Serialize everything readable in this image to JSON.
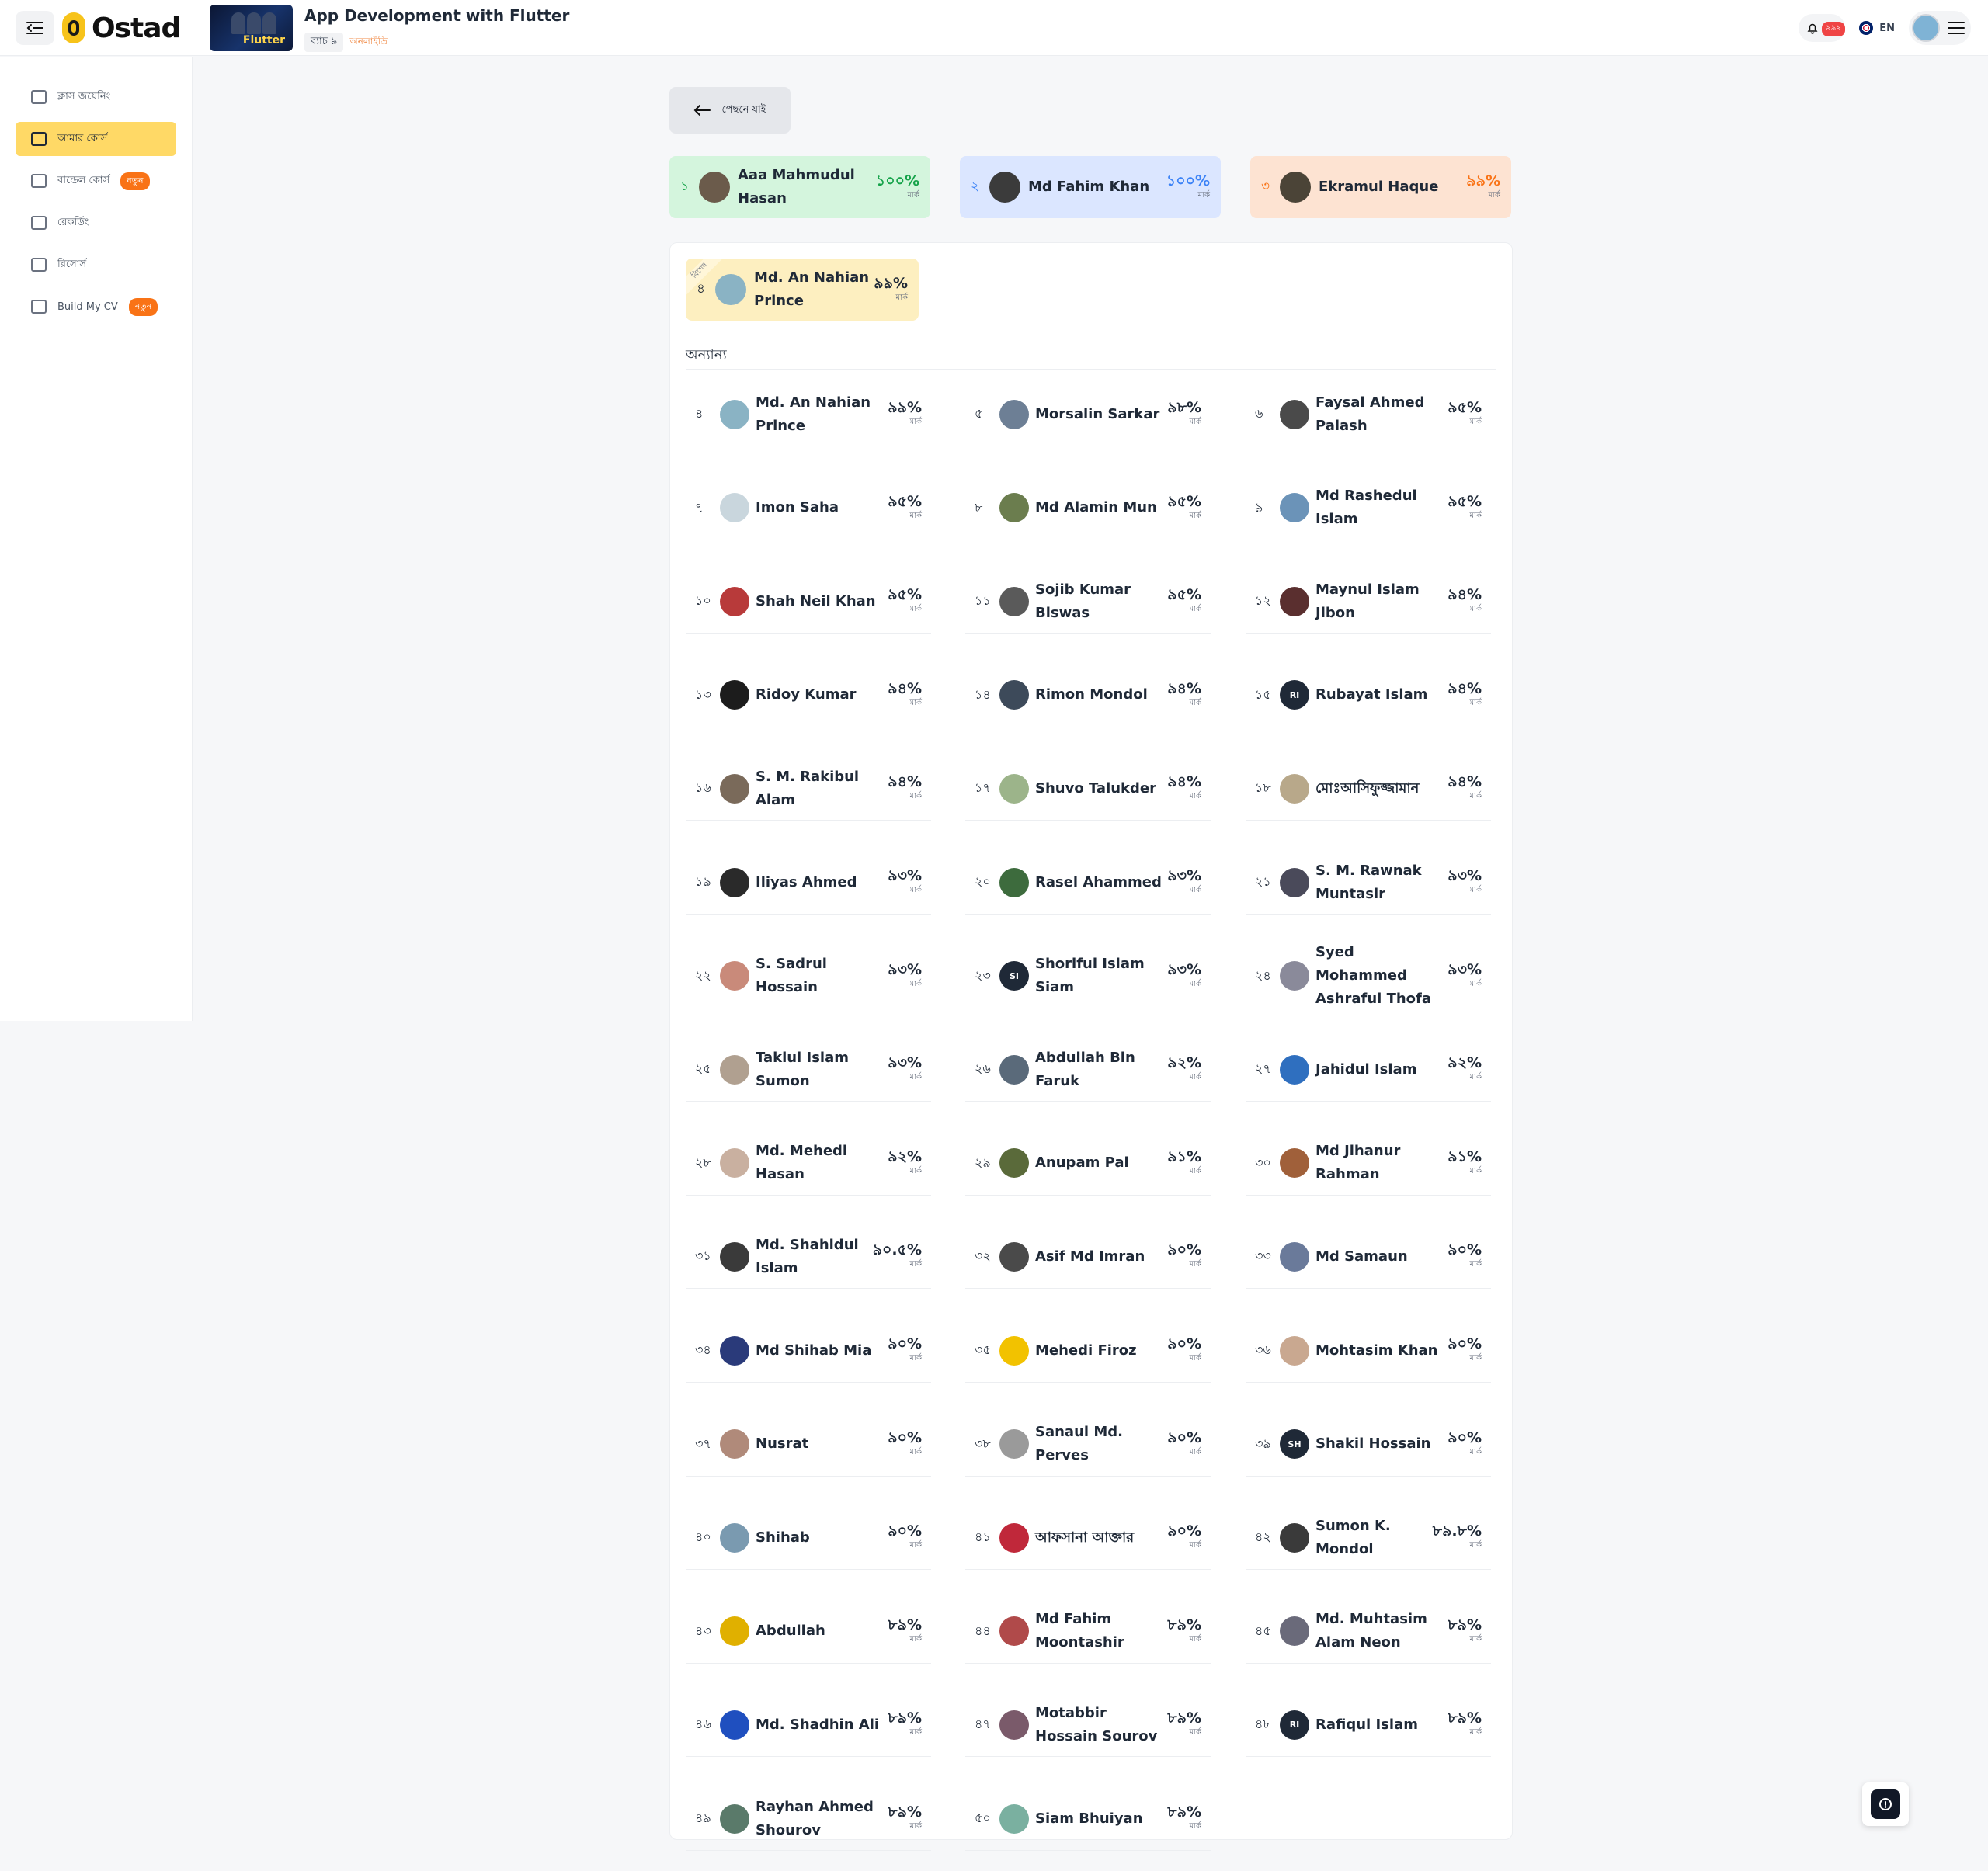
{
  "header": {
    "logo_text": "Ostad",
    "course_title": "App Development with Flutter",
    "batch_label": "ব্যাচ ৯",
    "batch_note": "অনলাইভ্রি",
    "thumb_text": "Flutter",
    "notification_count": "৯৯৯",
    "language": "EN"
  },
  "sidebar": {
    "items": [
      {
        "label": "ক্লাস জয়েনিং",
        "icon": "video-join-icon",
        "active": false,
        "badge": ""
      },
      {
        "label": "আমার কোর্স",
        "icon": "book-icon",
        "active": true,
        "badge": ""
      },
      {
        "label": "বান্ডেল কোর্স",
        "icon": "box-icon",
        "active": false,
        "badge": "নতুন"
      },
      {
        "label": "রেকর্ডিং",
        "icon": "play-icon",
        "active": false,
        "badge": ""
      },
      {
        "label": "রিসোর্স",
        "icon": "folders-icon",
        "active": false,
        "badge": ""
      },
      {
        "label": "Build My CV",
        "icon": "document-icon",
        "active": false,
        "badge": "নতুন"
      }
    ]
  },
  "back_label": "পেছনে যাই",
  "score_unit": "মার্ক",
  "podium": [
    {
      "rank": "১",
      "name": "Aaa Mahmudul Hasan",
      "score": "১০০%",
      "bg": "#d4f5dd",
      "accent": "#16a34a",
      "avatar": "#6b5b4b"
    },
    {
      "rank": "২",
      "name": "Md Fahim Khan",
      "score": "১০০%",
      "bg": "#dbe6ff",
      "accent": "#3b82f6",
      "avatar": "#3b3b3b"
    },
    {
      "rank": "৩",
      "name": "Ekramul Haque",
      "score": "৯৯%",
      "bg": "#fde3d2",
      "accent": "#f97316",
      "avatar": "#4b4437"
    }
  ],
  "special": {
    "ribbon": "বিশেষ",
    "rank": "৪",
    "name": "Md. An Nahian Prince",
    "score": "৯৯%",
    "avatar": "#8ab3c4"
  },
  "others_title": "অন্যান্য",
  "leaderboard": [
    {
      "rank": "৪",
      "name": "Md. An Nahian Prince",
      "score": "৯৯%",
      "avatar": "#8ab3c4",
      "initials": ""
    },
    {
      "rank": "৫",
      "name": "Morsalin Sarkar",
      "score": "৯৮%",
      "avatar": "#6d7f95",
      "initials": ""
    },
    {
      "rank": "৬",
      "name": "Faysal Ahmed Palash",
      "score": "৯৫%",
      "avatar": "#4a4a4a",
      "initials": ""
    },
    {
      "rank": "৭",
      "name": "Imon Saha",
      "score": "৯৫%",
      "avatar": "#c9d6dd",
      "initials": ""
    },
    {
      "rank": "৮",
      "name": "Md Alamin Mun",
      "score": "৯৫%",
      "avatar": "#6b7d4e",
      "initials": ""
    },
    {
      "rank": "৯",
      "name": "Md Rashedul Islam",
      "score": "৯৫%",
      "avatar": "#6b93b8",
      "initials": ""
    },
    {
      "rank": "১০",
      "name": "Shah Neil Khan",
      "score": "৯৫%",
      "avatar": "#b83a3a",
      "initials": ""
    },
    {
      "rank": "১১",
      "name": "Sojib Kumar Biswas",
      "score": "৯৫%",
      "avatar": "#5a5a5a",
      "initials": ""
    },
    {
      "rank": "১২",
      "name": "Maynul Islam Jibon",
      "score": "৯৪%",
      "avatar": "#5a2f2f",
      "initials": ""
    },
    {
      "rank": "১৩",
      "name": "Ridoy Kumar",
      "score": "৯৪%",
      "avatar": "#1c1c1c",
      "initials": ""
    },
    {
      "rank": "১৪",
      "name": "Rimon Mondol",
      "score": "৯৪%",
      "avatar": "#3d4a5a",
      "initials": ""
    },
    {
      "rank": "১৫",
      "name": "Rubayat Islam",
      "score": "৯৪%",
      "avatar": "#1f2937",
      "initials": "RI"
    },
    {
      "rank": "১৬",
      "name": "S. M. Rakibul Alam",
      "score": "৯৪%",
      "avatar": "#7a6a5a",
      "initials": ""
    },
    {
      "rank": "১৭",
      "name": "Shuvo Talukder",
      "score": "৯৪%",
      "avatar": "#9cb48a",
      "initials": ""
    },
    {
      "rank": "১৮",
      "name": "মোঃআসিফুজ্জামান",
      "score": "৯৪%",
      "avatar": "#b8a88a",
      "initials": ""
    },
    {
      "rank": "১৯",
      "name": "Iliyas Ahmed",
      "score": "৯৩%",
      "avatar": "#2a2a2a",
      "initials": ""
    },
    {
      "rank": "২০",
      "name": "Rasel Ahammed",
      "score": "৯৩%",
      "avatar": "#3d6b3d",
      "initials": ""
    },
    {
      "rank": "২১",
      "name": "S. M. Rawnak Muntasir",
      "score": "৯৩%",
      "avatar": "#4a4a5a",
      "initials": ""
    },
    {
      "rank": "২২",
      "name": "S. Sadrul Hossain",
      "score": "৯৩%",
      "avatar": "#c98a7a",
      "initials": ""
    },
    {
      "rank": "২৩",
      "name": "Shoriful Islam Siam",
      "score": "৯৩%",
      "avatar": "#1f2937",
      "initials": "SI"
    },
    {
      "rank": "২৪",
      "name": "Syed Mohammed Ashraful Thofa",
      "score": "৯৩%",
      "avatar": "#8a8a9a",
      "initials": ""
    },
    {
      "rank": "২৫",
      "name": "Takiul Islam Sumon",
      "score": "৯৩%",
      "avatar": "#b0a090",
      "initials": ""
    },
    {
      "rank": "২৬",
      "name": "Abdullah Bin Faruk",
      "score": "৯২%",
      "avatar": "#5a6a7a",
      "initials": ""
    },
    {
      "rank": "২৭",
      "name": "Jahidul Islam",
      "score": "৯২%",
      "avatar": "#2f6fbf",
      "initials": ""
    },
    {
      "rank": "২৮",
      "name": "Md. Mehedi Hasan",
      "score": "৯২%",
      "avatar": "#c9b0a0",
      "initials": ""
    },
    {
      "rank": "২৯",
      "name": "Anupam Pal",
      "score": "৯১%",
      "avatar": "#5a6a3a",
      "initials": ""
    },
    {
      "rank": "৩০",
      "name": "Md Jihanur Rahman",
      "score": "৯১%",
      "avatar": "#a0603a",
      "initials": ""
    },
    {
      "rank": "৩১",
      "name": "Md. Shahidul Islam",
      "score": "৯০.৫%",
      "avatar": "#3a3a3a",
      "initials": ""
    },
    {
      "rank": "৩২",
      "name": "Asif Md Imran",
      "score": "৯০%",
      "avatar": "#4a4a4a",
      "initials": ""
    },
    {
      "rank": "৩৩",
      "name": "Md Samaun",
      "score": "৯০%",
      "avatar": "#6a7a9a",
      "initials": ""
    },
    {
      "rank": "৩৪",
      "name": "Md Shihab Mia",
      "score": "৯০%",
      "avatar": "#2a3a7a",
      "initials": ""
    },
    {
      "rank": "৩৫",
      "name": "Mehedi Firoz",
      "score": "৯০%",
      "avatar": "#f2c200",
      "initials": ""
    },
    {
      "rank": "৩৬",
      "name": "Mohtasim Khan",
      "score": "৯০%",
      "avatar": "#c9a890",
      "initials": ""
    },
    {
      "rank": "৩৭",
      "name": "Nusrat",
      "score": "৯০%",
      "avatar": "#b08a7a",
      "initials": ""
    },
    {
      "rank": "৩৮",
      "name": "Sanaul Md. Perves",
      "score": "৯০%",
      "avatar": "#9a9a9a",
      "initials": ""
    },
    {
      "rank": "৩৯",
      "name": "Shakil Hossain",
      "score": "৯০%",
      "avatar": "#1f2937",
      "initials": "SH"
    },
    {
      "rank": "৪০",
      "name": "Shihab",
      "score": "৯০%",
      "avatar": "#7a9ab0",
      "initials": ""
    },
    {
      "rank": "৪১",
      "name": "আফসানা আক্তার",
      "score": "৯০%",
      "avatar": "#c0283a",
      "initials": ""
    },
    {
      "rank": "৪২",
      "name": "Sumon K. Mondol",
      "score": "৮৯.৮%",
      "avatar": "#3a3a3a",
      "initials": ""
    },
    {
      "rank": "৪৩",
      "name": "Abdullah",
      "score": "৮৯%",
      "avatar": "#e0b000",
      "initials": ""
    },
    {
      "rank": "৪৪",
      "name": "Md Fahim Moontashir",
      "score": "৮৯%",
      "avatar": "#b04a4a",
      "initials": ""
    },
    {
      "rank": "৪৫",
      "name": "Md. Muhtasim Alam Neon",
      "score": "৮৯%",
      "avatar": "#6a6a7a",
      "initials": ""
    },
    {
      "rank": "৪৬",
      "name": "Md. Shadhin Ali",
      "score": "৮৯%",
      "avatar": "#1f4fbf",
      "initials": ""
    },
    {
      "rank": "৪৭",
      "name": "Motabbir Hossain Sourov",
      "score": "৮৯%",
      "avatar": "#7a5a6a",
      "initials": ""
    },
    {
      "rank": "৪৮",
      "name": "Rafiqul Islam",
      "score": "৮৯%",
      "avatar": "#1f2937",
      "initials": "RI"
    },
    {
      "rank": "৪৯",
      "name": "Rayhan Ahmed Shourov",
      "score": "৮৯%",
      "avatar": "#5a7a6a",
      "initials": ""
    },
    {
      "rank": "৫০",
      "name": "Siam Bhuiyan",
      "score": "৮৯%",
      "avatar": "#7ab0a0",
      "initials": ""
    }
  ]
}
